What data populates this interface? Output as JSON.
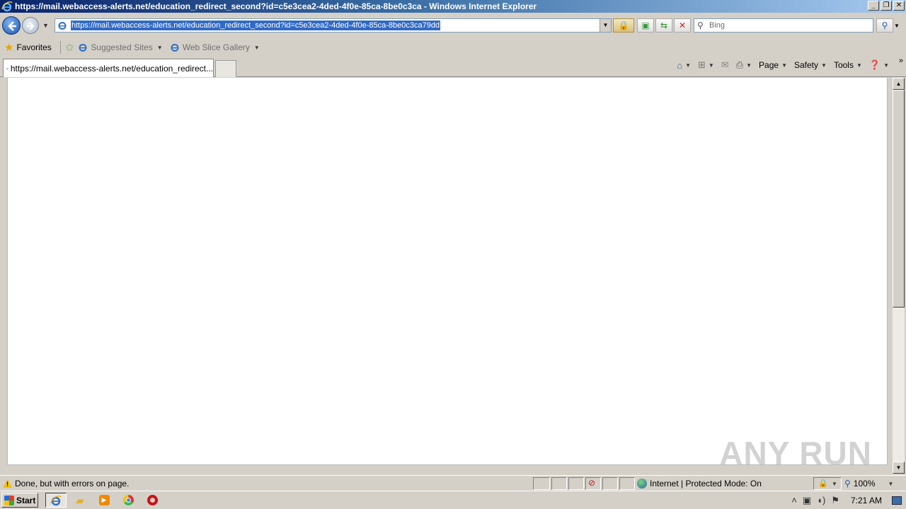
{
  "window": {
    "title": "https://mail.webaccess-alerts.net/education_redirect_second?id=c5e3cea2-4ded-4f0e-85ca-8be0c3ca - Windows Internet Explorer",
    "controls": [
      "_",
      "❐",
      "✕"
    ]
  },
  "address_bar": {
    "url": "https://mail.webaccess-alerts.net/education_redirect_second?id=c5e3cea2-4ded-4f0e-85ca-8be0c3ca79dd"
  },
  "search": {
    "placeholder": "Bing"
  },
  "favorites_bar": {
    "favorites_label": "Favorites",
    "suggested_sites": "Suggested Sites",
    "web_slice_gallery": "Web Slice Gallery"
  },
  "tabs": [
    {
      "label": "https://mail.webaccess-alerts.net/education_redirect..."
    }
  ],
  "command_bar": {
    "page": "Page",
    "safety": "Safety",
    "tools": "Tools"
  },
  "watermark": "ANY RUN",
  "status_bar": {
    "message": "Done, but with errors on page.",
    "zone": "Internet | Protected Mode: On",
    "zoom": "100%"
  },
  "taskbar": {
    "start_label": "Start",
    "clock": "7:21 AM"
  },
  "colors": {
    "titlebar_start": "#0a246a",
    "url_selection": "#316ac5",
    "chrome": "#d4d0c8"
  }
}
